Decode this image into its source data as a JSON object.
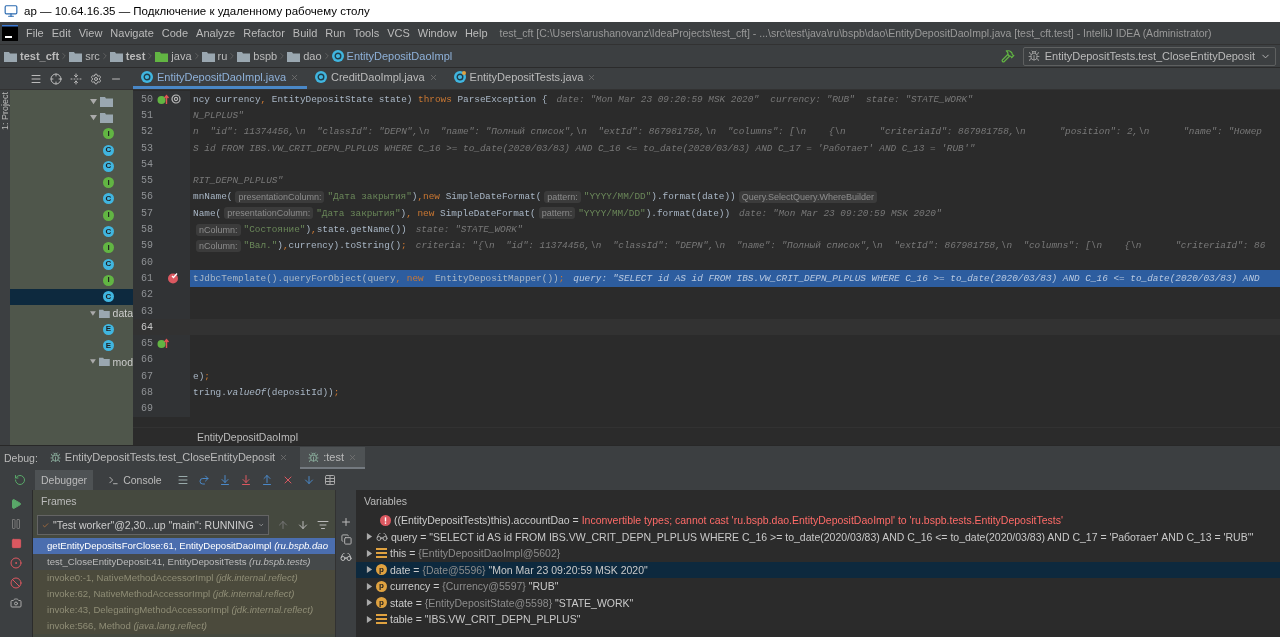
{
  "title_bar": {
    "title": "ap — 10.64.16.35 — Подключение к удаленному рабочему столу"
  },
  "menu": [
    "File",
    "Edit",
    "View",
    "Navigate",
    "Code",
    "Analyze",
    "Refactor",
    "Build",
    "Run",
    "Tools",
    "VCS",
    "Window",
    "Help"
  ],
  "window_title": "test_cft [C:\\Users\\arushanovanz\\IdeaProjects\\test_cft] - ...\\src\\test\\java\\ru\\bspb\\dao\\EntityDepositDaoImpl.java [test_cft.test] - IntelliJ IDEA (Administrator)",
  "breadcrumbs": [
    {
      "label": "test_cft",
      "kind": "module"
    },
    {
      "label": "src",
      "kind": "folder"
    },
    {
      "label": "test",
      "kind": "module"
    },
    {
      "label": "java",
      "kind": "source"
    },
    {
      "label": "ru",
      "kind": "package"
    },
    {
      "label": "bspb",
      "kind": "package"
    },
    {
      "label": "dao",
      "kind": "package"
    },
    {
      "label": "EntityDepositDaoImpl",
      "kind": "class"
    }
  ],
  "run_config": {
    "label": "EntityDepositTests.test_CloseEntityDeposit"
  },
  "side_stripe": {
    "label": "1: Project"
  },
  "editor_tabs": [
    {
      "label": "EntityDepositDaoImpl.java",
      "kind": "class",
      "selected": true
    },
    {
      "label": "CreditDaoImpl.java",
      "kind": "class",
      "selected": false
    },
    {
      "label": "EntityDepositTests.java",
      "kind": "test",
      "selected": false
    }
  ],
  "project_tree": [
    {
      "kind": "folder",
      "expanded": true,
      "selected": false
    },
    {
      "kind": "folder",
      "expanded": true,
      "selected": false,
      "children": [
        {
          "kind": "interface",
          "badge": "I",
          "selected": false
        },
        {
          "kind": "class",
          "badge": "C",
          "selected": false
        },
        {
          "kind": "class",
          "badge": "C",
          "selected": false
        },
        {
          "kind": "interface",
          "badge": "I",
          "selected": false
        },
        {
          "kind": "class",
          "badge": "C",
          "selected": false
        },
        {
          "kind": "interface",
          "badge": "I",
          "selected": false
        },
        {
          "kind": "class",
          "badge": "C",
          "selected": false
        },
        {
          "kind": "interface",
          "badge": "I",
          "selected": false
        },
        {
          "kind": "class",
          "badge": "C",
          "selected": false
        },
        {
          "kind": "interface",
          "badge": "I",
          "selected": false
        },
        {
          "kind": "class",
          "badge": "C",
          "selected": true
        }
      ]
    },
    {
      "kind": "folder",
      "label": "data",
      "expanded": true,
      "selected": false,
      "children": [
        {
          "kind": "enum",
          "badge": "E",
          "selected": false
        },
        {
          "kind": "enum",
          "badge": "E",
          "selected": false
        }
      ]
    },
    {
      "kind": "folder",
      "label": "mod",
      "expanded": true,
      "selected": false
    }
  ],
  "editor": {
    "lines": [
      {
        "number": "50",
        "override": true,
        "annotated": true,
        "breakpoint": false,
        "selected": false,
        "caret": false,
        "segments": [
          {
            "kind": "plain",
            "text": "ncy currency"
          },
          {
            "kind": "keyword",
            "text": ","
          },
          {
            "kind": "plain",
            "text": " EntityDepositState state) "
          },
          {
            "kind": "keyword",
            "text": "throws"
          },
          {
            "kind": "plain",
            "text": " ParseException {"
          },
          {
            "kind": "value",
            "text": "date: \"Mon Mar 23 09:20:59 MSK 2020\"  currency: \"RUB\"  state: \"STATE_WORK\""
          }
        ]
      },
      {
        "number": "51",
        "override": false,
        "annotated": false,
        "breakpoint": false,
        "selected": false,
        "caret": false,
        "segments": [
          {
            "kind": "value",
            "text": "N_PLPLUS\""
          }
        ]
      },
      {
        "number": "52",
        "override": false,
        "annotated": false,
        "breakpoint": false,
        "selected": false,
        "caret": false,
        "segments": [
          {
            "kind": "value",
            "text": "n  \"id\": 11374456,\\n  \"classId\": \"DEPN\",\\n  \"name\": \"Полный список\",\\n  \"extId\": 867981758,\\n  \"columns\": [\\n    {\\n      \"criteriaId\": 867981758,\\n      \"position\": 2,\\n      \"name\": \"Номер"
          }
        ]
      },
      {
        "number": "53",
        "override": false,
        "annotated": false,
        "breakpoint": false,
        "selected": false,
        "caret": false,
        "segments": [
          {
            "kind": "value",
            "text": "S id FROM IBS.VW_CRIT_DEPN_PLPLUS WHERE C_16 >= to_date(2020/03/83) AND C_16 <= to_date(2020/03/83) AND C_17 = 'Работает' AND C_13 = 'RUB'\""
          }
        ]
      },
      {
        "number": "54",
        "override": false,
        "annotated": false,
        "breakpoint": false,
        "selected": false,
        "caret": false
      },
      {
        "number": "55",
        "override": false,
        "annotated": false,
        "breakpoint": false,
        "selected": false,
        "caret": false,
        "segments": [
          {
            "kind": "value",
            "text": "RIT_DEPN_PLPLUS\""
          }
        ]
      },
      {
        "number": "56",
        "override": false,
        "annotated": false,
        "breakpoint": false,
        "selected": false,
        "caret": false,
        "segments": [
          {
            "kind": "plain",
            "text": "mnName("
          },
          {
            "kind": "hint",
            "text": "presentationColumn:"
          },
          {
            "kind": "string",
            "text": "\"Дата закрытия\""
          },
          {
            "kind": "plain",
            "text": ")"
          },
          {
            "kind": "keyword",
            "text": ",new"
          },
          {
            "kind": "plain",
            "text": " SimpleDateFormat("
          },
          {
            "kind": "hint",
            "text": "pattern:"
          },
          {
            "kind": "string",
            "text": "\"YYYY/MM/DD\""
          },
          {
            "kind": "plain",
            "text": ").format(date))"
          },
          {
            "kind": "hint",
            "text": "Query.SelectQuery.WhereBuilder"
          }
        ]
      },
      {
        "number": "57",
        "override": false,
        "annotated": false,
        "breakpoint": false,
        "selected": false,
        "caret": false,
        "segments": [
          {
            "kind": "plain",
            "text": "Name("
          },
          {
            "kind": "hint",
            "text": "presentationColumn:"
          },
          {
            "kind": "string",
            "text": "\"Дата закрытия\""
          },
          {
            "kind": "plain",
            "text": ")"
          },
          {
            "kind": "keyword",
            "text": ", new"
          },
          {
            "kind": "plain",
            "text": " SimpleDateFormat("
          },
          {
            "kind": "hint",
            "text": "pattern:"
          },
          {
            "kind": "string",
            "text": "\"YYYY/MM/DD\""
          },
          {
            "kind": "plain",
            "text": ").format(date))"
          },
          {
            "kind": "value",
            "text": "date: \"Mon Mar 23 09:20:59 MSK 2020\""
          }
        ]
      },
      {
        "number": "58",
        "override": false,
        "annotated": false,
        "breakpoint": false,
        "selected": false,
        "caret": false,
        "segments": [
          {
            "kind": "hint",
            "text": "nColumn:"
          },
          {
            "kind": "string",
            "text": "\"Состояние\""
          },
          {
            "kind": "plain",
            "text": ")"
          },
          {
            "kind": "keyword",
            "text": ","
          },
          {
            "kind": "plain",
            "text": "state.getName())"
          },
          {
            "kind": "value",
            "text": "state: \"STATE_WORK\""
          }
        ]
      },
      {
        "number": "59",
        "override": false,
        "annotated": false,
        "breakpoint": false,
        "selected": false,
        "caret": false,
        "segments": [
          {
            "kind": "hint",
            "text": "nColumn:"
          },
          {
            "kind": "string",
            "text": "\"Вал.\""
          },
          {
            "kind": "plain",
            "text": ")"
          },
          {
            "kind": "keyword",
            "text": ","
          },
          {
            "kind": "plain",
            "text": "currency).toString()"
          },
          {
            "kind": "keyword",
            "text": ";"
          },
          {
            "kind": "value",
            "text": "criteria: \"{\\n  \"id\": 11374456,\\n  \"classId\": \"DEPN\",\\n  \"name\": \"Полный список\",\\n  \"extId\": 867981758,\\n  \"columns\": [\\n    {\\n      \"criteriaId\": 86"
          }
        ]
      },
      {
        "number": "60",
        "override": false,
        "annotated": false,
        "breakpoint": false,
        "selected": false,
        "caret": false
      },
      {
        "number": "61",
        "override": false,
        "annotated": false,
        "breakpoint": true,
        "selected": true,
        "caret": false,
        "segments": [
          {
            "kind": "plain",
            "text": "tJdbcTemplate().queryForObject(query"
          },
          {
            "kind": "keyword",
            "text": ", new"
          },
          {
            "kind": "plain",
            "text": "  EntityDepositMapper())"
          },
          {
            "kind": "keyword",
            "text": ";"
          },
          {
            "kind": "value",
            "text": "query: \"SELECT id AS id FROM IBS.VW_CRIT_DEPN_PLPLUS WHERE C_16 >= to_date(2020/03/83) AND C_16 <= to_date(2020/03/83) AND"
          }
        ]
      },
      {
        "number": "62",
        "override": false,
        "annotated": false,
        "breakpoint": false,
        "selected": false,
        "caret": false
      },
      {
        "number": "63",
        "override": false,
        "annotated": false,
        "breakpoint": false,
        "selected": false,
        "caret": false
      },
      {
        "number": "64",
        "override": false,
        "annotated": false,
        "breakpoint": false,
        "selected": false,
        "caret": true
      },
      {
        "number": "65",
        "override": true,
        "annotated": false,
        "breakpoint": false,
        "selected": false,
        "caret": false
      },
      {
        "number": "66",
        "override": false,
        "annotated": false,
        "breakpoint": false,
        "selected": false,
        "caret": false
      },
      {
        "number": "67",
        "override": false,
        "annotated": false,
        "breakpoint": false,
        "selected": false,
        "caret": false,
        "segments": [
          {
            "kind": "plain",
            "text": "e)"
          },
          {
            "kind": "keyword",
            "text": ";"
          }
        ]
      },
      {
        "number": "68",
        "override": false,
        "annotated": false,
        "breakpoint": false,
        "selected": false,
        "caret": false,
        "segments": [
          {
            "kind": "plain",
            "text": "tring."
          },
          {
            "kind": "italic",
            "text": "valueOf"
          },
          {
            "kind": "plain",
            "text": "(depositId))"
          },
          {
            "kind": "keyword",
            "text": ";"
          }
        ]
      },
      {
        "number": "69",
        "override": false,
        "annotated": false,
        "breakpoint": false,
        "selected": false,
        "caret": false
      }
    ],
    "breadcrumb": "EntityDepositDaoImpl"
  },
  "debug": {
    "label": "Debug:",
    "sessions": [
      {
        "label": "EntityDepositTests.test_CloseEntityDeposit",
        "selected": false
      },
      {
        "label": ":test",
        "selected": true
      }
    ],
    "tabs": [
      {
        "label": "Debugger",
        "kind": "debugger",
        "selected": true
      },
      {
        "label": "Console",
        "kind": "console",
        "selected": false
      }
    ],
    "frames_title": "Frames",
    "thread": "\"Test worker\"@2,30...up \"main\": RUNNING",
    "frames": [
      {
        "text": "getEntityDepositsForClose:61, EntityDepositDaoImpl *(ru.bspb.dao*",
        "selected": true,
        "library": false
      },
      {
        "text": "test_CloseEntityDeposit:41, EntityDepositTests *(ru.bspb.tests)*",
        "selected": false,
        "library": false
      },
      {
        "text": "invoke0:-1, NativeMethodAccessorImpl *(jdk.internal.reflect)*",
        "selected": false,
        "library": true
      },
      {
        "text": "invoke:62, NativeMethodAccessorImpl *(jdk.internal.reflect)*",
        "selected": false,
        "library": true
      },
      {
        "text": "invoke:43, DelegatingMethodAccessorImpl *(jdk.internal.reflect)*",
        "selected": false,
        "library": true
      },
      {
        "text": "invoke:566, Method *(java.lang.reflect)*",
        "selected": false,
        "library": true
      }
    ],
    "variables_title": "Variables",
    "variables": [
      {
        "kind": "error",
        "name": "((EntityDepositTests)this).accountDao = ",
        "value": "Inconvertible types; cannot cast 'ru.bspb.dao.EntityDepositDaoImpl' to 'ru.bspb.tests.EntityDepositTests'",
        "selected": false
      },
      {
        "kind": "watch",
        "name": "query = ",
        "value": "\"SELECT id AS id FROM IBS.VW_CRIT_DEPN_PLPLUS WHERE C_16 >= to_date(2020/03/83) AND C_16 <= to_date(2020/03/83) AND C_17 = 'Работает' AND C_13 = 'RUB'\"",
        "selected": false
      },
      {
        "kind": "field",
        "name": "this = ",
        "type": "{EntityDepositDaoImpl@5602}",
        "selected": false
      },
      {
        "kind": "param",
        "badge": "p",
        "name": "date = ",
        "type": "{Date@5596} ",
        "value": "\"Mon Mar 23 09:20:59 MSK 2020\"",
        "selected": true
      },
      {
        "kind": "param",
        "badge": "p",
        "name": "currency = ",
        "type": "{Currency@5597} ",
        "value": "\"RUB\"",
        "selected": false
      },
      {
        "kind": "param",
        "badge": "p",
        "name": "state = ",
        "type": "{EntityDepositState@5598} ",
        "value": "\"STATE_WORK\"",
        "selected": false
      },
      {
        "kind": "field",
        "name": "table = ",
        "value": "\"IBS.VW_CRIT_DEPN_PLPLUS\"",
        "selected": false
      }
    ]
  }
}
